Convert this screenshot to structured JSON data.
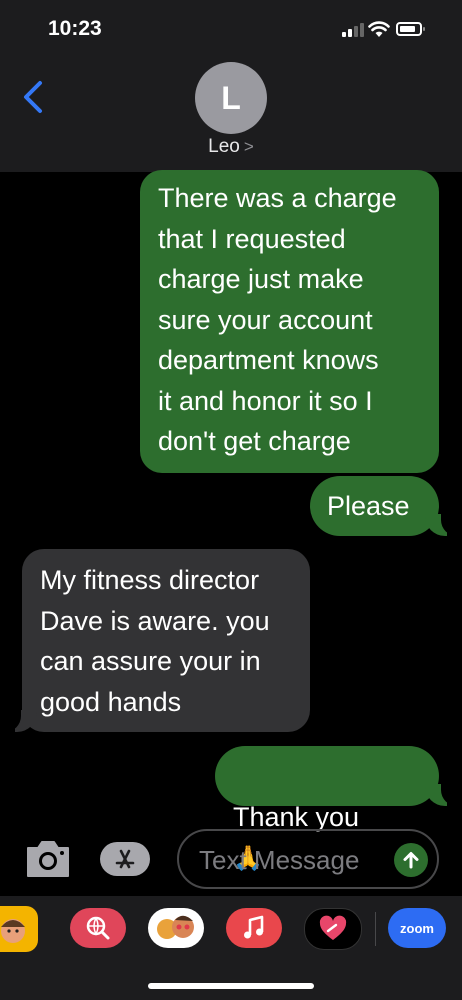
{
  "status_bar": {
    "time": "10:23"
  },
  "contact": {
    "initial": "L",
    "name": "Leo"
  },
  "messages": [
    {
      "direction": "outgoing",
      "text": "There was a charge\nthat I requested\ncharge just make\nsure your account\ndepartment knows\nit and honor it so I\ndon't get charge"
    },
    {
      "direction": "outgoing",
      "text": "Please"
    },
    {
      "direction": "incoming",
      "text": "My fitness director\nDave is aware. you\ncan assure your in\ngood hands"
    },
    {
      "direction": "outgoing",
      "text": "Thank you",
      "emoji": "🙏"
    }
  ],
  "composer": {
    "placeholder": "Text Message"
  },
  "app_drawer": {
    "apps": [
      "memoji-icon",
      "image-search-icon",
      "memoji-stickers-icon",
      "music-icon",
      "digital-touch-icon"
    ],
    "zoom_label": "zoom"
  },
  "colors": {
    "outgoing_bubble": "#2d6e2e",
    "incoming_bubble": "#333335",
    "header_bg": "#1c1c1e",
    "accent_blue": "#3478f6"
  }
}
